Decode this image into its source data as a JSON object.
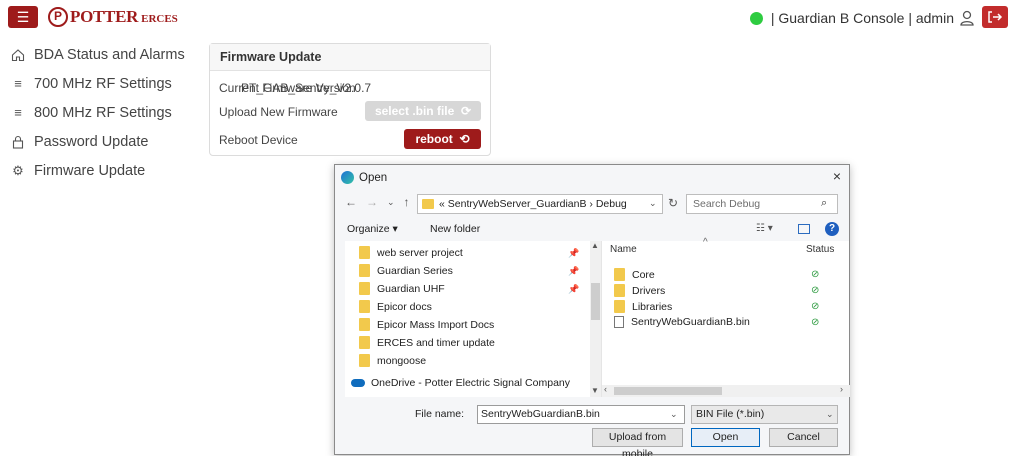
{
  "header": {
    "menu_icon": "hamburger-icon",
    "logo_mark": "P",
    "logo_text": "POTTER",
    "logo_sub": "ERCES",
    "status_color": "#2ecc40",
    "status_text": "| Guardian B Console | admin",
    "user_icon": "user-icon",
    "logout_icon": "logout-icon"
  },
  "sidebar": {
    "items": [
      {
        "label": "BDA Status and Alarms",
        "icon": "home-icon"
      },
      {
        "label": "700 MHz RF Settings",
        "icon": "list-icon"
      },
      {
        "label": "800 MHz RF Settings",
        "icon": "list-icon"
      },
      {
        "label": "Password Update",
        "icon": "lock-icon"
      },
      {
        "label": "Firmware Update",
        "icon": "gear-icon"
      }
    ]
  },
  "firmware": {
    "title": "Firmware Update",
    "current_label": "Current Firmware Version",
    "current_value": "PT_GAB_Sentry_V2.0.7",
    "upload_label": "Upload New Firmware",
    "select_button": "select .bin file",
    "reboot_label": "Reboot Device",
    "reboot_button": "reboot"
  },
  "dialog": {
    "title": "Open",
    "close": "×",
    "path_prefix": "«",
    "path_folder": "SentryWebServer_GuardianB",
    "path_sep": "›",
    "path_current": "Debug",
    "search_placeholder": "Search Debug",
    "organize": "Organize ▾",
    "new_folder": "New folder",
    "nav_items": [
      {
        "label": "web server project",
        "pinned": true
      },
      {
        "label": "Guardian Series",
        "pinned": true
      },
      {
        "label": "Guardian UHF",
        "pinned": true
      },
      {
        "label": "Epicor docs",
        "pinned": false
      },
      {
        "label": "Epicor Mass Import Docs",
        "pinned": false
      },
      {
        "label": "ERCES and timer update",
        "pinned": false
      },
      {
        "label": "mongoose",
        "pinned": false
      }
    ],
    "onedrive": "OneDrive - Potter Electric Signal Company",
    "col_name": "Name",
    "col_status": "Status",
    "files": [
      {
        "name": "Core",
        "type": "folder"
      },
      {
        "name": "Drivers",
        "type": "folder"
      },
      {
        "name": "Libraries",
        "type": "folder"
      },
      {
        "name": "SentryWebGuardianB.bin",
        "type": "file"
      }
    ],
    "file_name_label": "File name:",
    "file_name_value": "SentryWebGuardianB.bin",
    "file_type": "BIN File (*.bin)",
    "upload_mobile": "Upload from mobile",
    "open": "Open",
    "cancel": "Cancel"
  }
}
